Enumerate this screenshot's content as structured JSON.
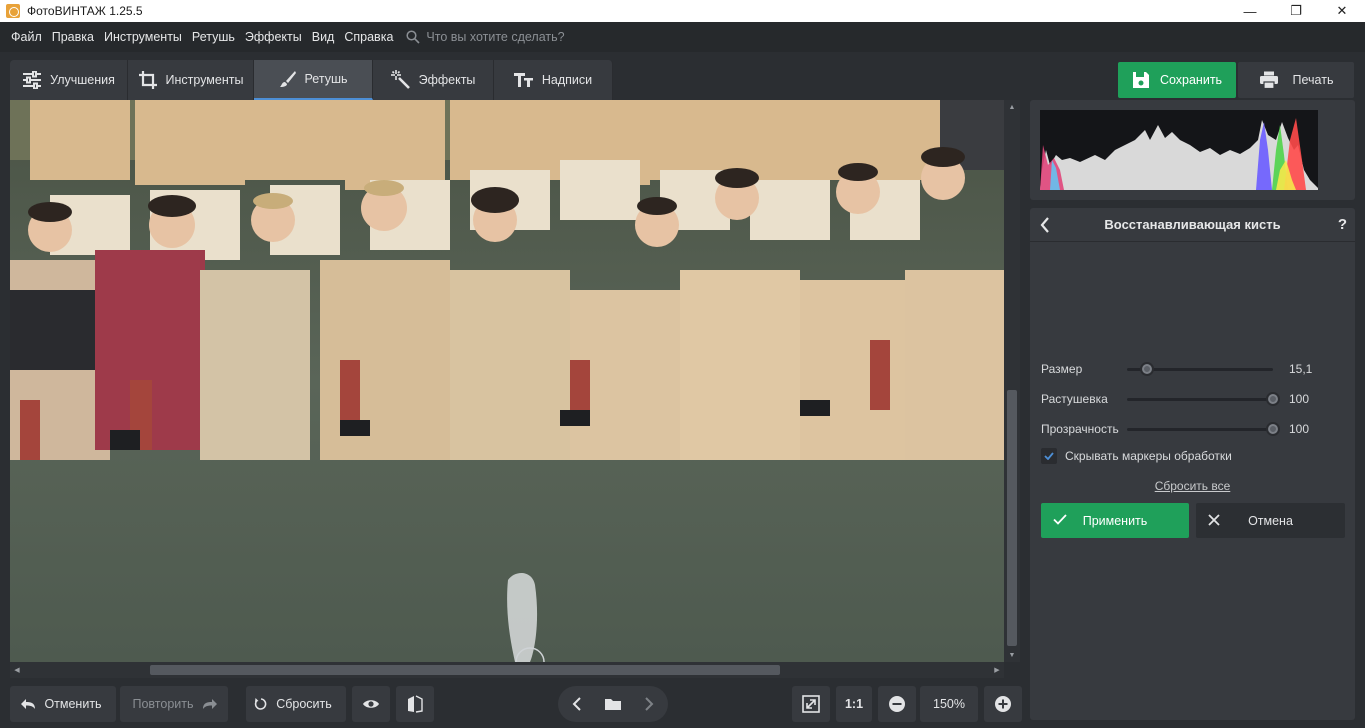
{
  "window": {
    "title": "ФотоВИНТАЖ 1.25.5",
    "controls": {
      "minimize": "—",
      "maximize": "❐",
      "close": "✕"
    }
  },
  "menu": {
    "items": [
      "Файл",
      "Правка",
      "Инструменты",
      "Ретушь",
      "Эффекты",
      "Вид",
      "Справка"
    ],
    "search_placeholder": "Что вы хотите сделать?"
  },
  "tabs": [
    {
      "label": "Улучшения",
      "icon": "sliders-icon",
      "active": false
    },
    {
      "label": "Инструменты",
      "icon": "crop-icon",
      "active": false
    },
    {
      "label": "Ретушь",
      "icon": "brush-icon",
      "active": true
    },
    {
      "label": "Эффекты",
      "icon": "magic-wand-icon",
      "active": false
    },
    {
      "label": "Надписи",
      "icon": "text-icon",
      "active": false
    }
  ],
  "actions": {
    "save_label": "Сохранить",
    "print_label": "Печать"
  },
  "bottom_toolbar": {
    "undo_label": "Отменить",
    "redo_label": "Повторить",
    "reset_label": "Сбросить",
    "actual_size_label": "1:1",
    "zoom_value": "150%"
  },
  "panel": {
    "title": "Восстанавливающая кисть",
    "help": "?",
    "sliders": [
      {
        "label": "Размер",
        "value": "15,1",
        "fraction": 0.14
      },
      {
        "label": "Растушевка",
        "value": "100",
        "fraction": 1.0
      },
      {
        "label": "Прозрачность",
        "value": "100",
        "fraction": 1.0
      }
    ],
    "hide_markers_label": "Скрывать маркеры обработки",
    "hide_markers_checked": true,
    "reset_all_label": "Сбросить все",
    "apply_label": "Применить",
    "cancel_label": "Отмена"
  },
  "colors": {
    "accent_green": "#1fa05a",
    "tab_active_underline": "#4d8fd6",
    "background": "#2b2e32",
    "panel": "#373a3f"
  }
}
